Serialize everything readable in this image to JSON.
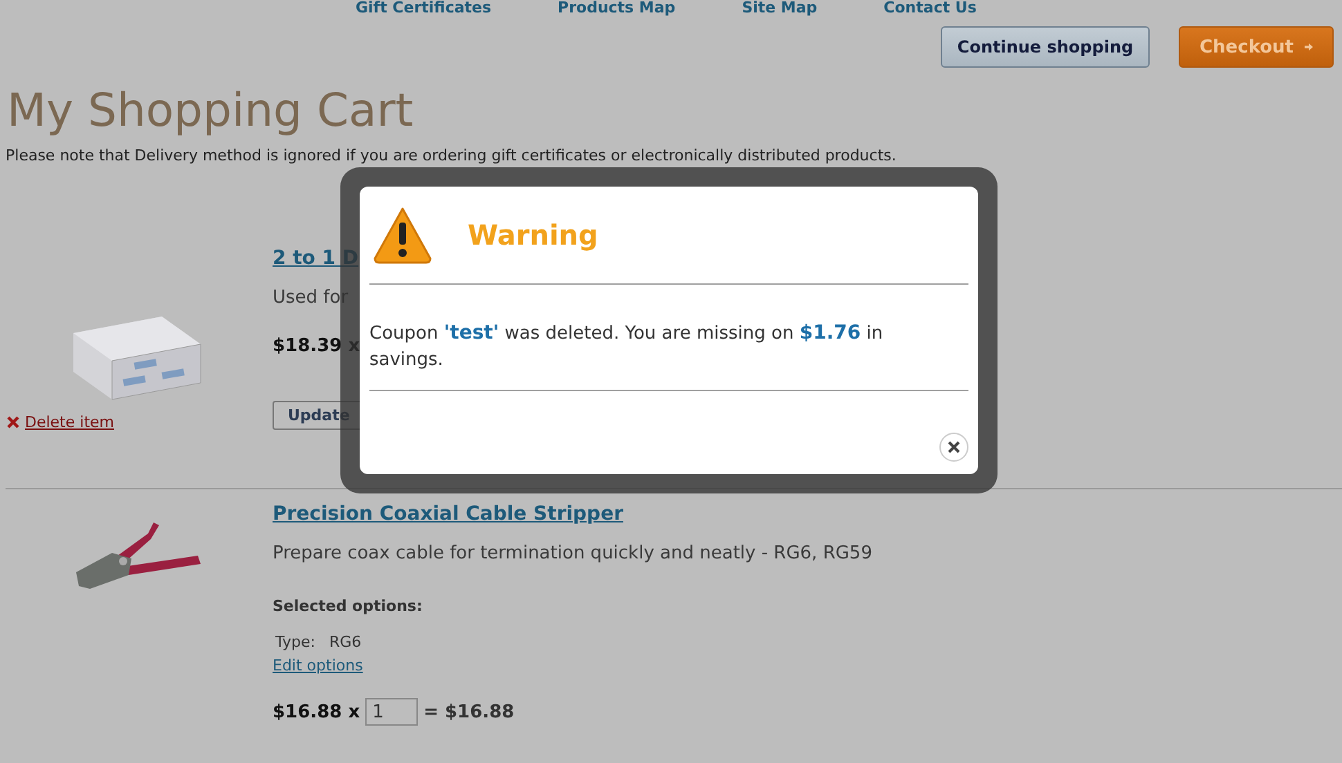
{
  "nav": {
    "links": [
      "Gift Certificates",
      "Products Map",
      "Site Map",
      "Contact Us"
    ]
  },
  "actions": {
    "continue": "Continue shopping",
    "checkout": "Checkout"
  },
  "title": "My Shopping Cart",
  "note": "Please note that Delivery method is ignored if you are ordering gift certificates or electronically distributed products.",
  "items": [
    {
      "kind": "switch-box",
      "title": "2 to 1 D",
      "description": "Used for",
      "price": "$18.39 x",
      "update_button": "Update",
      "delete_link": "Delete item"
    },
    {
      "kind": "cable-stripper",
      "title": "Precision Coaxial Cable Stripper",
      "description": "Prepare coax cable for termination quickly and neatly - RG6, RG59",
      "options_heading": "Selected options:",
      "options": [
        {
          "label": "Type:",
          "value": "RG6"
        }
      ],
      "edit_link": "Edit options",
      "price": "$16.88 x",
      "quantity": "1",
      "total": "= $16.88"
    }
  ],
  "dialog": {
    "title": "Warning",
    "message": "Coupon **'test'** was deleted. You are missing on **$1.76** in savings."
  }
}
